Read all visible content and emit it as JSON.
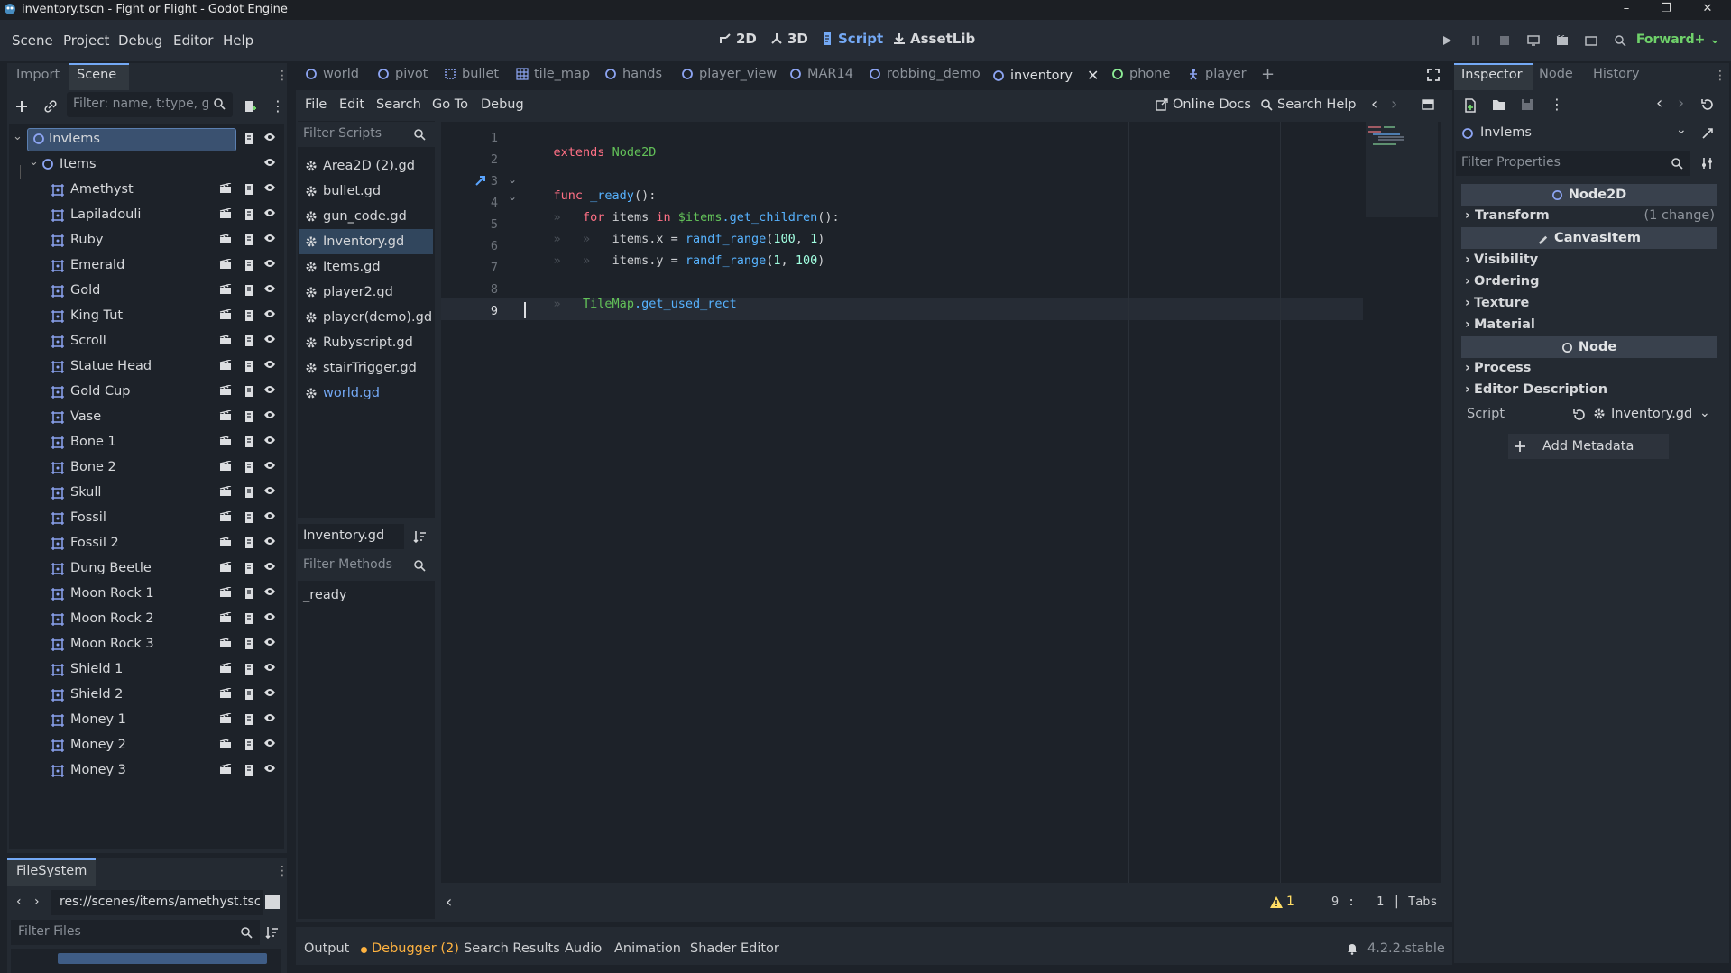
{
  "window": {
    "title": "inventory.tscn - Fight or Flight - Godot Engine",
    "controls": [
      "–",
      "❐",
      "✕"
    ]
  },
  "menu": [
    "Scene",
    "Project",
    "Debug",
    "Editor",
    "Help"
  ],
  "modes": [
    {
      "label": "2D",
      "icon": "2d-icon"
    },
    {
      "label": "3D",
      "icon": "3d-icon"
    },
    {
      "label": "Script",
      "icon": "script-icon",
      "active": true
    },
    {
      "label": "AssetLib",
      "icon": "assetlib-icon"
    }
  ],
  "renderer": "Forward+",
  "left_dock": {
    "tabs": [
      "Import",
      "Scene"
    ],
    "active_tab": "Scene",
    "filter_placeholder": "Filter: name, t:type, g:",
    "root": "InvIems",
    "group": "Items",
    "items": [
      "Amethyst",
      "Lapiladouli",
      "Ruby",
      "Emerald",
      "Gold",
      "King Tut",
      "Scroll",
      "Statue Head",
      "Gold Cup",
      "Vase",
      "Bone 1",
      "Bone 2",
      "Skull",
      "Fossil",
      "Fossil 2",
      "Dung Beetle",
      "Moon Rock 1",
      "Moon Rock 2",
      "Moon Rock 3",
      "Shield 1",
      "Shield 2",
      "Money 1",
      "Money 2",
      "Money 3"
    ]
  },
  "filesystem": {
    "tab": "FileSystem",
    "path": "res://scenes/items/amethyst.tscn",
    "filter_placeholder": "Filter Files"
  },
  "editor_tabs": [
    {
      "label": "world",
      "icon": "node2d-icon"
    },
    {
      "label": "pivot",
      "icon": "node2d-icon"
    },
    {
      "label": "bullet",
      "icon": "area-icon"
    },
    {
      "label": "tile_map",
      "icon": "tilemap-icon"
    },
    {
      "label": "hands",
      "icon": "node2d-icon"
    },
    {
      "label": "player_view",
      "icon": "node2d-icon"
    },
    {
      "label": "MAR14",
      "icon": "node2d-icon"
    },
    {
      "label": "robbing_demo",
      "icon": "node2d-icon"
    },
    {
      "label": "inventory",
      "icon": "node2d-icon",
      "active": true
    },
    {
      "label": "phone",
      "icon": "control-icon"
    },
    {
      "label": "player",
      "icon": "player-icon"
    }
  ],
  "script_menu": [
    "File",
    "Edit",
    "Search",
    "Go To",
    "Debug"
  ],
  "script_actions": {
    "online_docs": "Online Docs",
    "search_help": "Search Help"
  },
  "scripts_filter_placeholder": "Filter Scripts",
  "scripts": [
    "Area2D (2).gd",
    "bullet.gd",
    "gun_code.gd",
    "Inventory.gd",
    "Items.gd",
    "player2.gd",
    "player(demo).gd",
    "Rubyscript.gd",
    "stairTrigger.gd",
    "world.gd"
  ],
  "selected_script": "Inventory.gd",
  "current_script_label": "Inventory.gd",
  "methods_filter_placeholder": "Filter Methods",
  "methods": [
    "_ready"
  ],
  "code": {
    "line_numbers": [
      "1",
      "2",
      "3",
      "4",
      "5",
      "6",
      "7",
      "8",
      "9"
    ],
    "l1": {
      "kw": "extends",
      "type": "Node2D"
    },
    "l3": {
      "kw": "func",
      "name": "_ready",
      "rest": "():"
    },
    "l4": {
      "kw": "for",
      "v": "items",
      "kw2": "in",
      "node": "$items",
      "call": ".get_children",
      "rest": "():"
    },
    "l5": {
      "lhs": "items.x = ",
      "call": "randf_range",
      "open": "(",
      "a": "100",
      "sep": ", ",
      "b": "1",
      "close": ")"
    },
    "l6": {
      "lhs": "items.y = ",
      "call": "randf_range",
      "open": "(",
      "a": "1",
      "sep": ", ",
      "b": "100",
      "close": ")"
    },
    "l8": {
      "type": "TileMap",
      "rest": ".get_used_rect"
    }
  },
  "status": {
    "warnings": "1",
    "line": "9",
    "sep": ":",
    "col": "1",
    "indent": "Tabs"
  },
  "bottom_tabs": [
    "Output",
    "Debugger (2)",
    "Search Results",
    "Audio",
    "Animation",
    "Shader Editor"
  ],
  "version": "4.2.2.stable",
  "inspector": {
    "tabs": [
      "Inspector",
      "Node",
      "History"
    ],
    "node_name": "InvIems",
    "filter_placeholder": "Filter Properties",
    "class1": "Node2D",
    "transform": "Transform",
    "transform_note": "(1 change)",
    "class2": "CanvasItem",
    "canvas_sections": [
      "Visibility",
      "Ordering",
      "Texture",
      "Material"
    ],
    "class3": "Node",
    "node_sections": [
      "Process",
      "Editor Description"
    ],
    "script_label": "Script",
    "script_value": "Inventory.gd",
    "add_metadata": "Add Metadata"
  },
  "colors": {
    "accent": "#74a9f5",
    "renderer": "#6fd16a",
    "warning": "#ffdd65"
  }
}
